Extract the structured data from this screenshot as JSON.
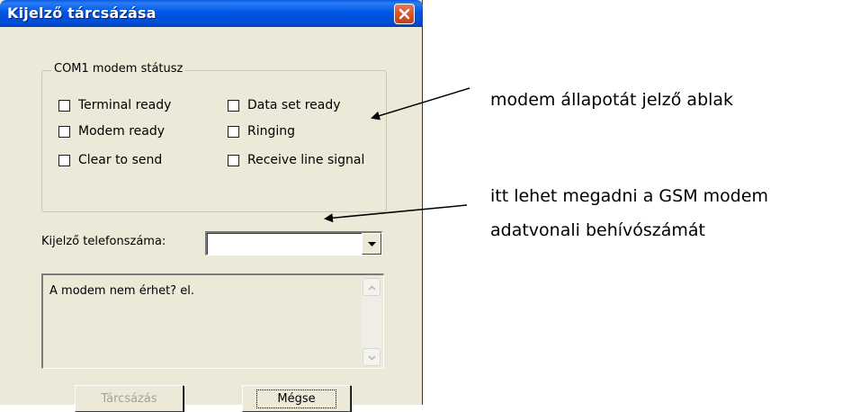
{
  "window": {
    "title": "Kijelző tárcsázása"
  },
  "status_group": {
    "legend": "COM1 modem státusz",
    "checkboxes": [
      {
        "label": "Terminal ready",
        "checked": false
      },
      {
        "label": "Data set ready",
        "checked": false
      },
      {
        "label": "Modem ready",
        "checked": false
      },
      {
        "label": "Ringing",
        "checked": false
      },
      {
        "label": "Clear to send",
        "checked": false
      },
      {
        "label": "Receive line signal",
        "checked": false
      }
    ]
  },
  "phone": {
    "label": "Kijelző telefonszáma:",
    "value": ""
  },
  "log": {
    "text": "A modem nem érhet? el."
  },
  "buttons": {
    "dial": {
      "label": "Tárcsázás",
      "enabled": false
    },
    "cancel": {
      "label": "Mégse",
      "enabled": true
    }
  },
  "annotations": {
    "status_window": "modem állapotát jelző ablak",
    "phone_line1": "itt lehet megadni a GSM modem",
    "phone_line2": "adatvonali behívószámát"
  },
  "colors": {
    "titlebar": "#0055e5",
    "close_button": "#d9532b",
    "dialog_bg": "#ece9d8",
    "disabled_text": "#a4a197"
  },
  "icons": {
    "close": "close-icon",
    "combo_dropdown": "chevron-down-icon",
    "scroll_up": "scroll-up-icon",
    "scroll_down": "scroll-down-icon"
  }
}
